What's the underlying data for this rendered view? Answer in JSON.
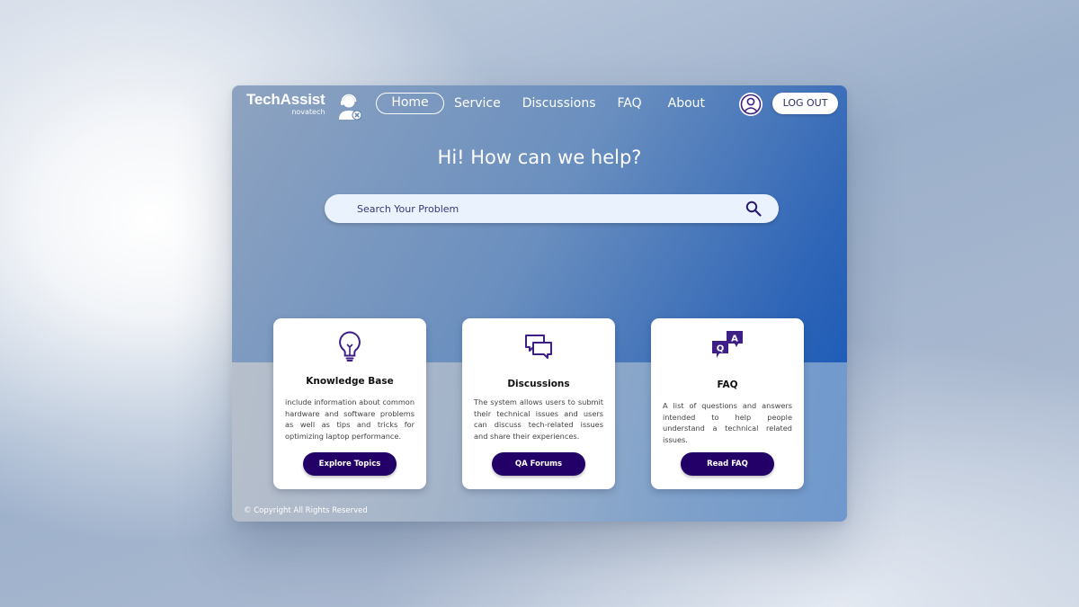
{
  "brand": {
    "name": "TechAssist",
    "tagline": "novatech"
  },
  "nav": {
    "home": "Home",
    "service": "Service",
    "discussions": "Discussions",
    "faq": "FAQ",
    "about": "About"
  },
  "header": {
    "logout_label": "LOG OUT",
    "user_icon": "user-circle-icon"
  },
  "hero": {
    "title": "Hi! How can we help?"
  },
  "search": {
    "placeholder": "Search Your Problem",
    "icon": "search-icon"
  },
  "cards": [
    {
      "icon": "lightbulb-icon",
      "title": "Knowledge Base",
      "description": "include information about common hardware and software problems as well as tips and tricks for optimizing laptop performance.",
      "button": "Explore Topics"
    },
    {
      "icon": "chat-bubbles-icon",
      "title": "Discussions",
      "description": "The system allows users to submit their technical issues and users can discuss tech-related issues and share their experiences.",
      "button": "QA Forums"
    },
    {
      "icon": "qa-bubbles-icon",
      "title": "FAQ",
      "description": "A list of questions and answers intended to help people understand a technical related issues.",
      "button": "Read FAQ"
    }
  ],
  "footer": {
    "copyright": "© Copyright All Rights Reserved"
  },
  "colors": {
    "accent": "#230067",
    "icon": "#3d1f85",
    "header_blue": "#0f56b8"
  }
}
